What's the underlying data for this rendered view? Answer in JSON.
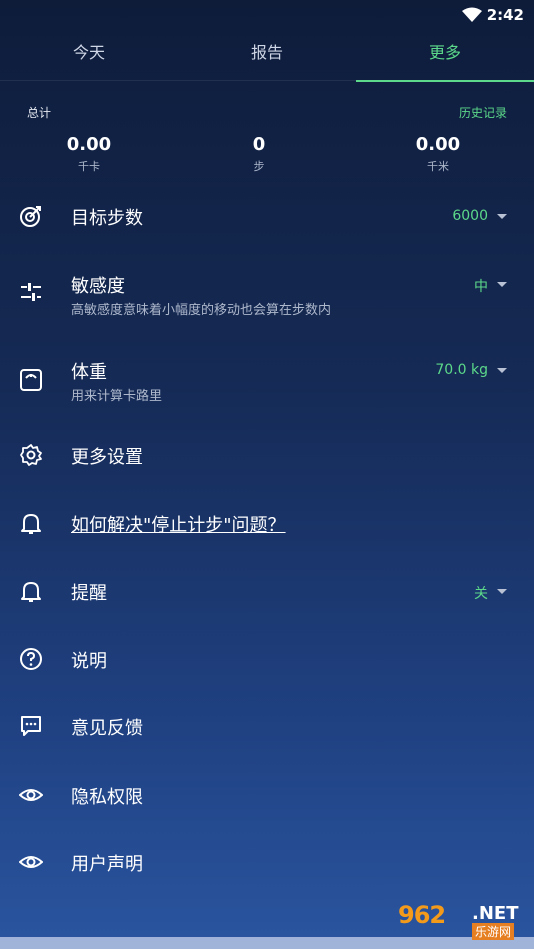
{
  "status": {
    "time": "2:42"
  },
  "tabs": [
    "今天",
    "报告",
    "更多"
  ],
  "summary": {
    "title": "总计",
    "history": "历史记录",
    "stats": [
      {
        "value": "0.00",
        "unit": "千卡"
      },
      {
        "value": "0",
        "unit": "步"
      },
      {
        "value": "0.00",
        "unit": "千米"
      }
    ]
  },
  "settings": {
    "goal": {
      "label": "目标步数",
      "value": "6000"
    },
    "sensitivity": {
      "label": "敏感度",
      "desc": "高敏感度意味着小幅度的移动也会算在步数内",
      "value": "中"
    },
    "weight": {
      "label": "体重",
      "desc": "用来计算卡路里",
      "value": "70.0 kg"
    },
    "more": {
      "label": "更多设置"
    },
    "solve": {
      "label": "如何解决\"停止计步\"问题？"
    },
    "reminder": {
      "label": "提醒",
      "value": "关"
    },
    "help": {
      "label": "说明"
    },
    "feedback": {
      "label": "意见反馈"
    },
    "privacy": {
      "label": "隐私权限"
    },
    "agreement": {
      "label": "用户声明"
    }
  },
  "watermark": {
    "num": "962",
    "net": ".NET",
    "sub": "乐游网"
  },
  "colors": {
    "accent": "#5cd98a",
    "bg_top": "#0e1c3a",
    "bg_bottom": "#2a55a0"
  }
}
